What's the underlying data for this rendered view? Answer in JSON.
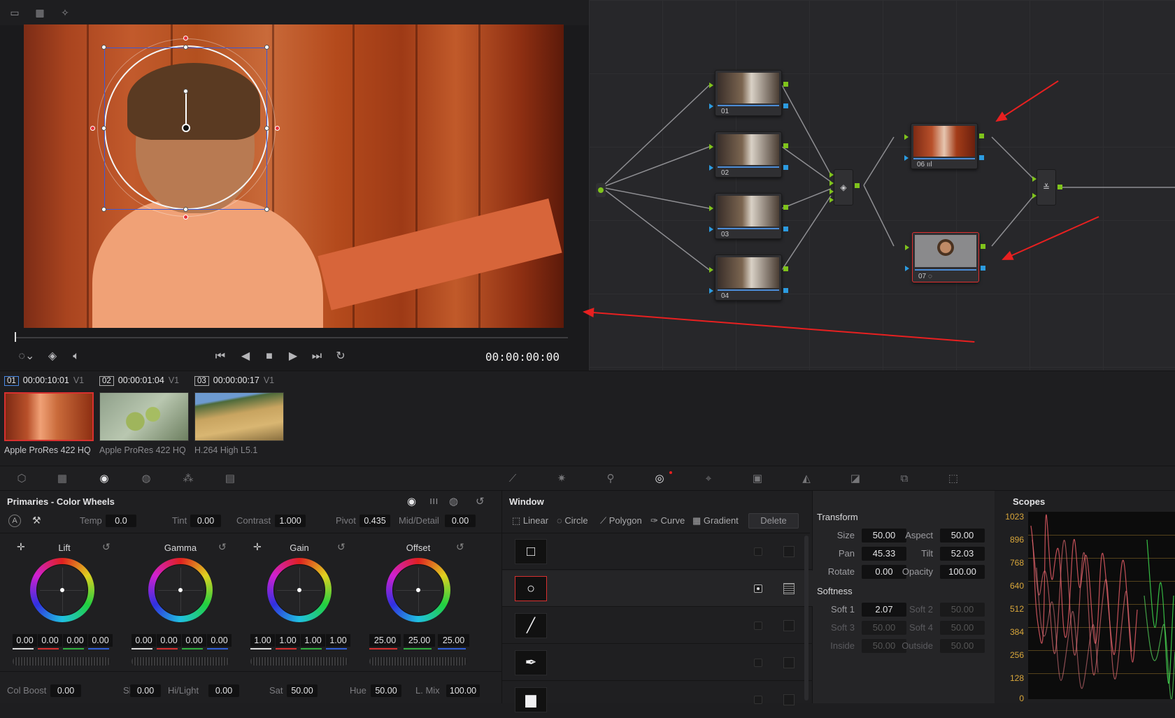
{
  "viewer": {
    "timecode": "00:00:00:00"
  },
  "nodes": [
    {
      "label": "01"
    },
    {
      "label": "02"
    },
    {
      "label": "03"
    },
    {
      "label": "04"
    },
    {
      "label": "06"
    },
    {
      "label": "07"
    }
  ],
  "clips": [
    {
      "num": "01",
      "timecode": "00:00:10:01",
      "track": "V1",
      "codec": "Apple ProRes 422 HQ"
    },
    {
      "num": "02",
      "timecode": "00:00:01:04",
      "track": "V1",
      "codec": "Apple ProRes 422 HQ"
    },
    {
      "num": "03",
      "timecode": "00:00:00:17",
      "track": "V1",
      "codec": "H.264 High L5.1"
    }
  ],
  "primaries": {
    "title": "Primaries - Color Wheels",
    "auto_label": "A",
    "temp_label": "Temp",
    "temp": "0.0",
    "tint_label": "Tint",
    "tint": "0.00",
    "contrast_label": "Contrast",
    "contrast": "1.000",
    "pivot_label": "Pivot",
    "pivot": "0.435",
    "middetail_label": "Mid/Detail",
    "middetail": "0.00",
    "wheels": [
      {
        "name": "Lift",
        "values": [
          "0.00",
          "0.00",
          "0.00",
          "0.00"
        ]
      },
      {
        "name": "Gamma",
        "values": [
          "0.00",
          "0.00",
          "0.00",
          "0.00"
        ]
      },
      {
        "name": "Gain",
        "values": [
          "1.00",
          "1.00",
          "1.00",
          "1.00"
        ]
      },
      {
        "name": "Offset",
        "values": [
          "25.00",
          "25.00",
          "25.00"
        ]
      }
    ],
    "colboost_label": "Col Boost",
    "colboost": "0.00",
    "shad_label": "Shad",
    "shad": "0.00",
    "hilight_label": "Hi/Light",
    "hilight": "0.00",
    "sat_label": "Sat",
    "sat": "50.00",
    "hue_label": "Hue",
    "hue": "50.00",
    "lmix_label": "L. Mix",
    "lmix": "100.00"
  },
  "window": {
    "title": "Window",
    "tools": [
      "Linear",
      "Circle",
      "Polygon",
      "Curve",
      "Gradient"
    ],
    "delete_label": "Delete"
  },
  "transform": {
    "title": "Transform",
    "size_label": "Size",
    "size": "50.00",
    "aspect_label": "Aspect",
    "aspect": "50.00",
    "pan_label": "Pan",
    "pan": "45.33",
    "tilt_label": "Tilt",
    "tilt": "52.03",
    "rotate_label": "Rotate",
    "rotate": "0.00",
    "opacity_label": "Opacity",
    "opacity": "100.00",
    "softness_title": "Softness",
    "soft1_label": "Soft 1",
    "soft1": "2.07",
    "soft2_label": "Soft 2",
    "soft2": "50.00",
    "soft3_label": "Soft 3",
    "soft3": "50.00",
    "soft4_label": "Soft 4",
    "soft4": "50.00",
    "inside_label": "Inside",
    "inside": "50.00",
    "outside_label": "Outside",
    "outside": "50.00"
  },
  "scopes": {
    "title": "Scopes",
    "ticks": [
      "1023",
      "896",
      "768",
      "640",
      "512",
      "384",
      "256",
      "128",
      "0"
    ]
  },
  "colors": {
    "accent_red": "#e82020",
    "node_green": "#7fc31c",
    "node_blue": "#2c9be0",
    "scope_tick": "#d8a63a"
  }
}
